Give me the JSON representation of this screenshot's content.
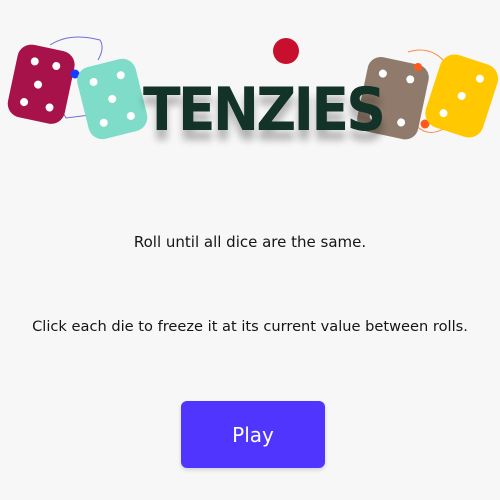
{
  "game": {
    "title": "TENZIES",
    "instructions": {
      "line1": "Roll until all dice are the same.",
      "line2": "Click each die to freeze it at its current value between rolls."
    },
    "play_label": "Play"
  },
  "logo_dice": [
    {
      "name": "crimson-die",
      "color": "#a8124a",
      "pips": 5
    },
    {
      "name": "teal-die",
      "color": "#7fdcc8",
      "pips": 5
    },
    {
      "name": "brown-die",
      "color": "#8f7a6b",
      "pips": 4
    },
    {
      "name": "yellow-die",
      "color": "#ffc800",
      "pips": 3
    }
  ],
  "colors": {
    "background": "#f7f7f7",
    "title": "#133328",
    "play_button": "#5035ff",
    "red_dot": "#c8102e",
    "blue_dot": "#1a3aff",
    "orange_dot": "#ff5a1a"
  }
}
